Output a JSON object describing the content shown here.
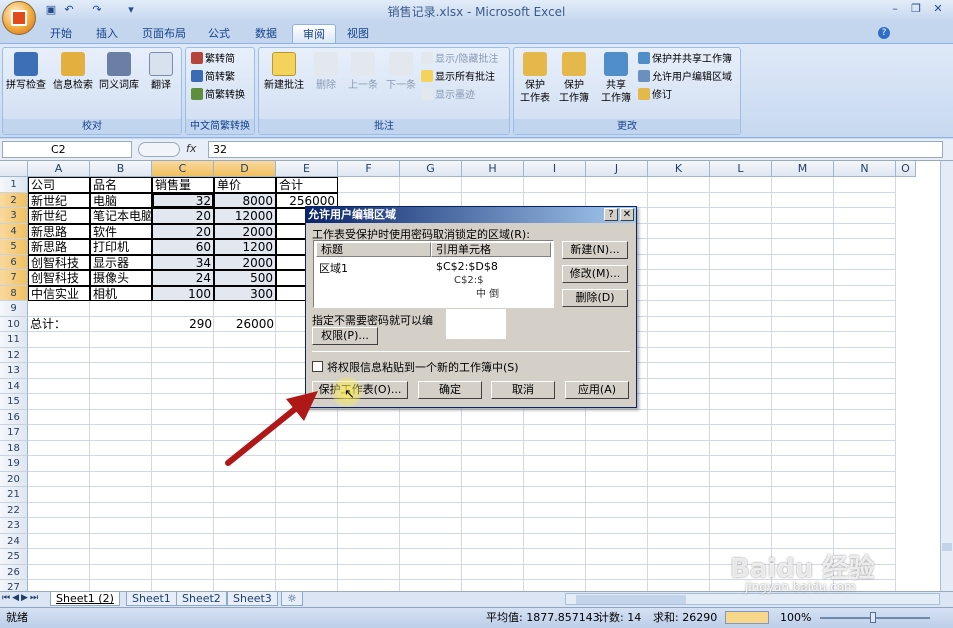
{
  "app": {
    "doc_title": "销售记录.xlsx - Microsoft Excel"
  },
  "tabs": [
    "开始",
    "插入",
    "页面布局",
    "公式",
    "数据",
    "审阅",
    "视图"
  ],
  "active_tab": "审阅",
  "ribbon": {
    "proofing": {
      "label": "校对",
      "buttons": [
        "拼写检查",
        "信息检索",
        "同义词库",
        "翻译"
      ]
    },
    "chinese": {
      "label": "中文简繁转换",
      "buttons": [
        "繁转简",
        "简转繁",
        "简繁转换"
      ]
    },
    "comments": {
      "label": "批注",
      "buttons": [
        "新建批注",
        "删除",
        "上一条",
        "下一条"
      ],
      "small": [
        "显示/隐藏批注",
        "显示所有批注",
        "显示墨迹"
      ]
    },
    "changes": {
      "label": "更改",
      "buttons": [
        "保护\n工作表",
        "保护\n工作簿",
        "共享\n工作簿"
      ],
      "small": [
        "保护并共享工作簿",
        "允许用户编辑区域",
        "修订"
      ]
    }
  },
  "formula_bar": {
    "name_box": "C2",
    "fx": "fx",
    "value": "32"
  },
  "columns": [
    "A",
    "B",
    "C",
    "D",
    "E",
    "F",
    "G",
    "H",
    "I",
    "J",
    "K",
    "L",
    "M",
    "N",
    "O"
  ],
  "rows": [
    [
      "公司",
      "品名",
      "销售量",
      "单价",
      "合计"
    ],
    [
      "新世纪",
      "电脑",
      "32",
      "8000",
      "256000"
    ],
    [
      "新世纪",
      "笔记本电脑",
      "20",
      "12000",
      "2"
    ],
    [
      "新思路",
      "软件",
      "20",
      "2000",
      ""
    ],
    [
      "新思路",
      "打印机",
      "60",
      "1200",
      ""
    ],
    [
      "创智科技",
      "显示器",
      "34",
      "2000",
      ""
    ],
    [
      "创智科技",
      "摄像头",
      "24",
      "500",
      ""
    ],
    [
      "中信实业",
      "相机",
      "100",
      "300",
      ""
    ],
    [
      "",
      "",
      "",
      "",
      ""
    ],
    [
      "总计：",
      "",
      "290",
      "26000",
      "7"
    ]
  ],
  "row_numbers": [
    "1",
    "2",
    "3",
    "4",
    "5",
    "6",
    "7",
    "8",
    "9",
    "10",
    "11",
    "12",
    "13",
    "14",
    "15",
    "16",
    "17",
    "18",
    "19",
    "20",
    "21",
    "22",
    "23",
    "24",
    "25",
    "26",
    "27"
  ],
  "sheet_tabs": [
    "Sheet1 (2)",
    "Sheet1",
    "Sheet2",
    "Sheet3"
  ],
  "status": {
    "ready": "就绪",
    "average": "平均值: 1877.857143",
    "count": "计数: 14",
    "sum": "求和: 26290",
    "zoom": "100%"
  },
  "dialog": {
    "title": "允许用户编辑区域",
    "unlock_label": "工作表受保护时使用密码取消锁定的区域(R):",
    "col_title": "标题",
    "col_ref": "引用单元格",
    "row_title": "区域1",
    "row_ref": "$C$2:$D$8",
    "fragment_ref": "C$2:$",
    "fragment_title": "中 倒",
    "new_btn": "新建(N)...",
    "modify_btn": "修改(M)...",
    "delete_btn": "删除(D)",
    "no_pwd_label": "指定不需要密码就可以编",
    "permission_btn": "权限(P)...",
    "paste_label": "将权限信息粘贴到一个新的工作簿中(S)",
    "protect_btn": "保护工作表(O)...",
    "ok_btn": "确定",
    "cancel_btn": "取消",
    "apply_btn": "应用(A)"
  },
  "watermark": {
    "text": "Baidu 经验",
    "url": "jingyan.baidu.com"
  },
  "colors": {
    "header_selected": "#f1c15f",
    "annotation_arrow": "#b01818",
    "dialog_title": "#0a246a"
  }
}
